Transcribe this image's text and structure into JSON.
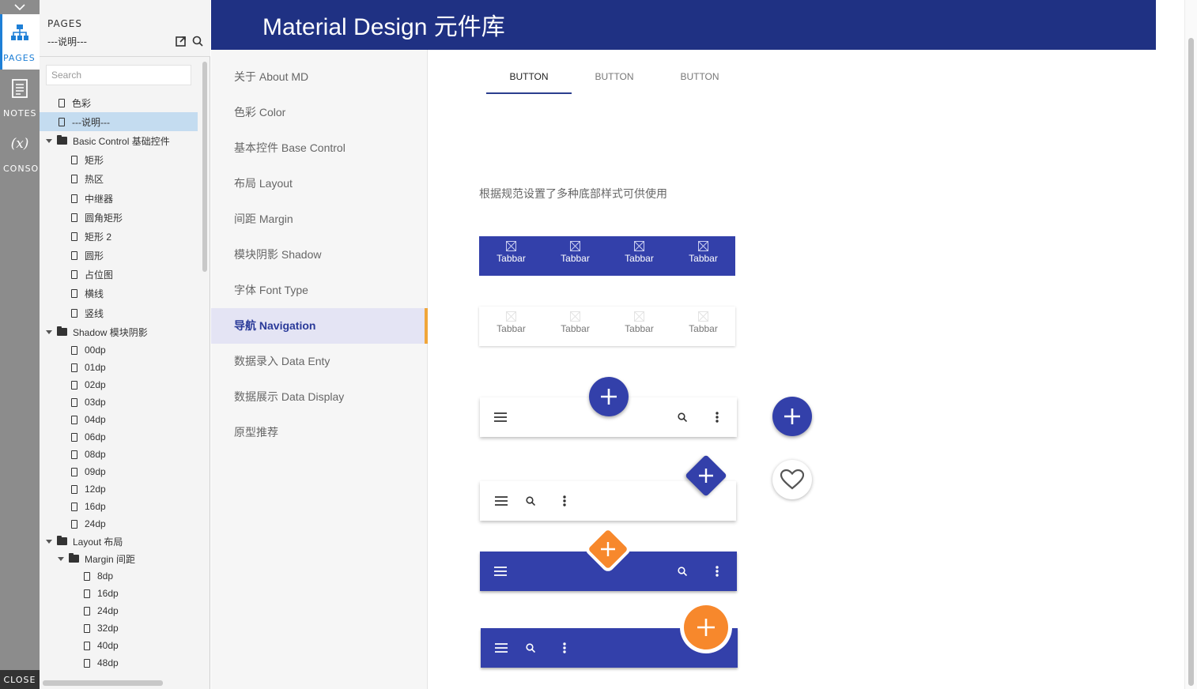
{
  "sidebar": {
    "tabs": [
      {
        "label": "PAGES",
        "icon": "sitemap-icon"
      },
      {
        "label": "NOTES",
        "icon": "notes-icon"
      },
      {
        "label": "CONSOLE",
        "icon": "variable-icon",
        "glyph": "(x)"
      }
    ],
    "close_label": "CLOSE"
  },
  "pages": {
    "title": "PAGES",
    "current": "---说明---",
    "search_placeholder": "Search",
    "tree": [
      {
        "label": "色彩",
        "type": "page",
        "level": 1
      },
      {
        "label": "---说明---",
        "type": "page",
        "level": 1,
        "selected": true
      },
      {
        "label": "Basic Control 基础控件",
        "type": "folder",
        "level": 1
      },
      {
        "label": "矩形",
        "type": "page",
        "level": 2
      },
      {
        "label": "热区",
        "type": "page",
        "level": 2
      },
      {
        "label": "中继器",
        "type": "page",
        "level": 2
      },
      {
        "label": "圆角矩形",
        "type": "page",
        "level": 2
      },
      {
        "label": "矩形 2",
        "type": "page",
        "level": 2
      },
      {
        "label": "圆形",
        "type": "page",
        "level": 2
      },
      {
        "label": "占位图",
        "type": "page",
        "level": 2
      },
      {
        "label": "横线",
        "type": "page",
        "level": 2
      },
      {
        "label": "竖线",
        "type": "page",
        "level": 2
      },
      {
        "label": "Shadow 模块阴影",
        "type": "folder",
        "level": 1
      },
      {
        "label": "00dp",
        "type": "page",
        "level": 2
      },
      {
        "label": "01dp",
        "type": "page",
        "level": 2
      },
      {
        "label": "02dp",
        "type": "page",
        "level": 2
      },
      {
        "label": "03dp",
        "type": "page",
        "level": 2
      },
      {
        "label": "04dp",
        "type": "page",
        "level": 2
      },
      {
        "label": "06dp",
        "type": "page",
        "level": 2
      },
      {
        "label": "08dp",
        "type": "page",
        "level": 2
      },
      {
        "label": "09dp",
        "type": "page",
        "level": 2
      },
      {
        "label": "12dp",
        "type": "page",
        "level": 2
      },
      {
        "label": "16dp",
        "type": "page",
        "level": 2
      },
      {
        "label": "24dp",
        "type": "page",
        "level": 2
      },
      {
        "label": "Layout 布局",
        "type": "folder",
        "level": 1
      },
      {
        "label": "Margin 间距",
        "type": "folder",
        "level": 2
      },
      {
        "label": "8dp",
        "type": "page",
        "level": 3
      },
      {
        "label": "16dp",
        "type": "page",
        "level": 3
      },
      {
        "label": "24dp",
        "type": "page",
        "level": 3
      },
      {
        "label": "32dp",
        "type": "page",
        "level": 3
      },
      {
        "label": "40dp",
        "type": "page",
        "level": 3
      },
      {
        "label": "48dp",
        "type": "page",
        "level": 3
      }
    ]
  },
  "app": {
    "title": "Material Design 元件库",
    "nav": [
      {
        "label": "关于 About MD"
      },
      {
        "label": "色彩 Color"
      },
      {
        "label": "基本控件 Base Control"
      },
      {
        "label": "布局 Layout"
      },
      {
        "label": "间距 Margin"
      },
      {
        "label": "模块阴影 Shadow"
      },
      {
        "label": "字体 Font Type"
      },
      {
        "label": "导航 Navigation",
        "active": true
      },
      {
        "label": "数据录入 Data Enty"
      },
      {
        "label": "数据展示 Data Display"
      },
      {
        "label": "原型推荐"
      }
    ],
    "tabs": [
      "BUTTON",
      "BUTTON",
      "BUTTON"
    ],
    "description": "根据规范设置了多种底部样式可供使用",
    "tabbar_label": "Tabbar"
  },
  "colors": {
    "header": "#1f3183",
    "primary": "#3340aa",
    "accent": "#f7882c",
    "active_marker": "#f0a63a"
  }
}
